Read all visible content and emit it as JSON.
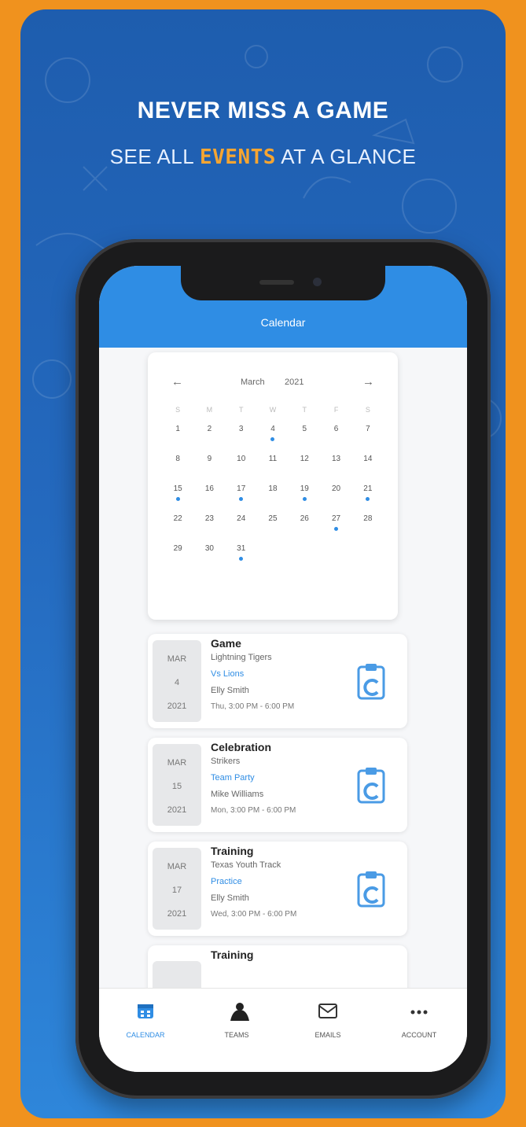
{
  "promo": {
    "headline": "NEVER MISS A GAME",
    "sub_before": "SEE ALL ",
    "sub_accent": "EVENTS",
    "sub_after": " AT A GLANCE"
  },
  "app": {
    "screen_title": "Calendar"
  },
  "calendar": {
    "prev_icon": "arrow-left-icon",
    "next_icon": "arrow-right-icon",
    "month": "March",
    "year": "2021",
    "weekdays": [
      "S",
      "M",
      "T",
      "W",
      "T",
      "F",
      "S"
    ],
    "weeks": [
      [
        "1",
        "2",
        "3",
        "4",
        "5",
        "6",
        "7"
      ],
      [
        "8",
        "9",
        "10",
        "11",
        "12",
        "13",
        "14"
      ],
      [
        "15",
        "16",
        "17",
        "18",
        "19",
        "20",
        "21"
      ],
      [
        "22",
        "23",
        "24",
        "25",
        "26",
        "27",
        "28"
      ],
      [
        "29",
        "30",
        "31",
        "",
        "",
        "",
        ""
      ]
    ],
    "event_days": [
      "4",
      "15",
      "17",
      "19",
      "21",
      "27",
      "31"
    ],
    "dot_color": "#2F8DE4"
  },
  "events": [
    {
      "type": "Game",
      "team": "Lightning Tigers",
      "title": "Vs Lions",
      "person": "Elly Smith",
      "time": "Thu, 3:00 PM - 6:00 PM",
      "month": "MAR",
      "day": "4",
      "year": "2021",
      "icon": "clipboard-icon"
    },
    {
      "type": "Celebration",
      "team": "Strikers",
      "title": "Team Party",
      "person": "Mike Williams",
      "time": "Mon, 3:00 PM - 6:00 PM",
      "month": "MAR",
      "day": "15",
      "year": "2021",
      "icon": "clipboard-icon"
    },
    {
      "type": "Training",
      "team": "Texas Youth Track",
      "title": "Practice",
      "person": "Elly Smith",
      "time": "Wed, 3:00 PM - 6:00 PM",
      "month": "MAR",
      "day": "17",
      "year": "2021",
      "icon": "clipboard-icon"
    },
    {
      "type": "Training",
      "team": "",
      "title": "",
      "person": "",
      "time": "",
      "month": "",
      "day": "",
      "year": "",
      "icon": ""
    }
  ],
  "tabs": [
    {
      "label": "CALENDAR",
      "icon": "calendar-icon",
      "active": true
    },
    {
      "label": "TEAMS",
      "icon": "teams-icon",
      "active": false
    },
    {
      "label": "EMAILS",
      "icon": "email-icon",
      "active": false
    },
    {
      "label": "ACCOUNT",
      "icon": "more-icon",
      "active": false
    }
  ],
  "colors": {
    "outer_background": "#F0921E",
    "card_blue": "#2469BE",
    "accent_orange": "#F6A531",
    "app_blue": "#2F8DE4"
  }
}
